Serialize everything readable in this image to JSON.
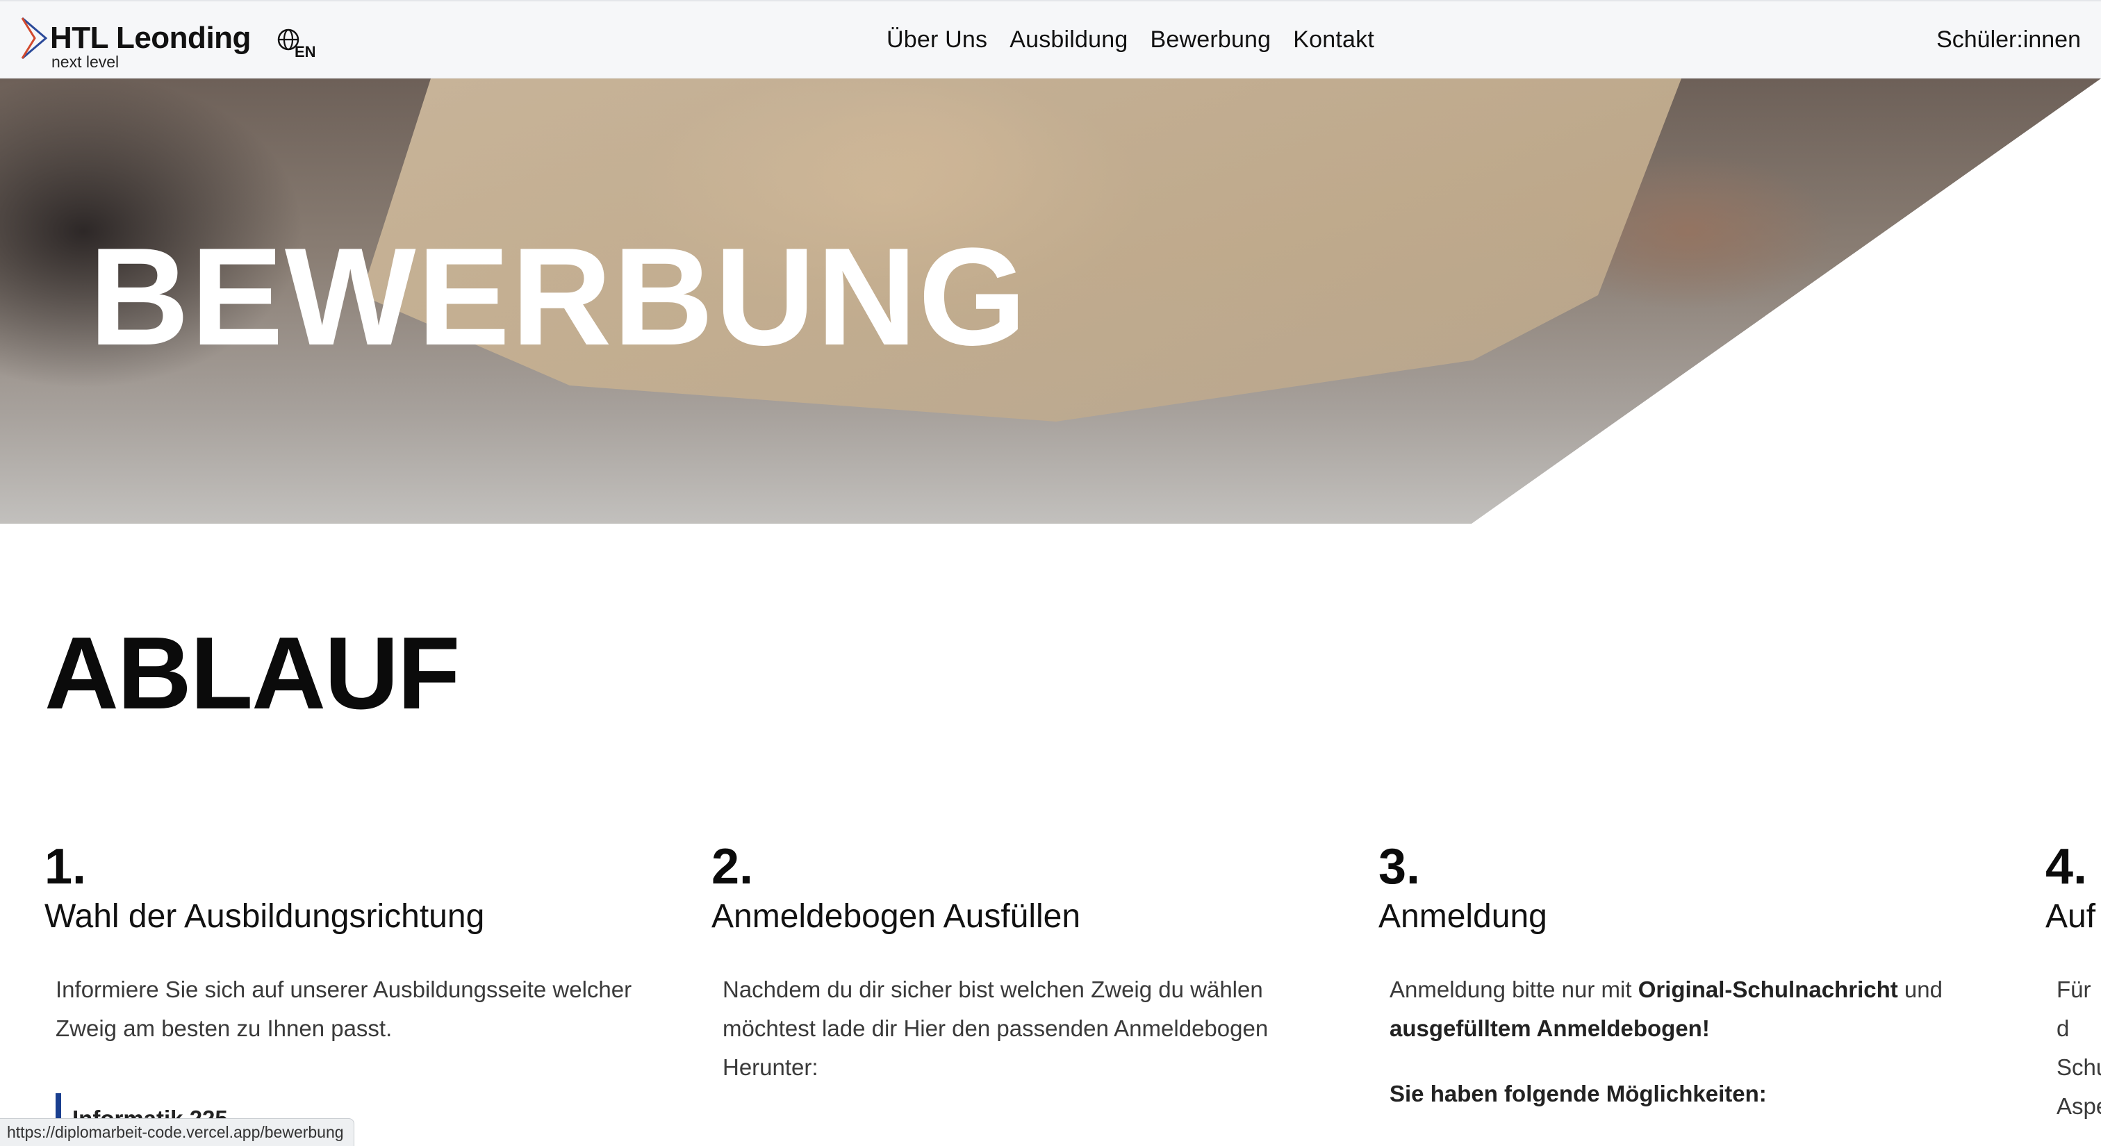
{
  "nav": {
    "logo_title": "HTL Leonding",
    "logo_subtitle": "next level",
    "language": "EN",
    "menu": [
      "Über Uns",
      "Ausbildung",
      "Bewerbung",
      "Kontakt"
    ],
    "students_link": "Schüler:innen"
  },
  "hero": {
    "title": "BEWERBUNG"
  },
  "section": {
    "title": "ABLAUF"
  },
  "steps": [
    {
      "number": "1.",
      "title": "Wahl der Ausbildungsrichtung",
      "body": "Informiere Sie sich auf unserer Ausbildungsseite welcher Zweig am besten zu Ihnen passt.",
      "info_partial": "Informatik 225"
    },
    {
      "number": "2.",
      "title": "Anmeldebogen Ausfüllen",
      "body": "Nachdem du dir sicher bist welchen Zweig du wählen möchtest lade dir Hier den passenden Anmeldebogen Herunter:"
    },
    {
      "number": "3.",
      "title": "Anmeldung",
      "body_prefix": "Anmeldung bitte nur mit ",
      "body_bold1": "Original-Schulnachricht",
      "body_mid": " und ",
      "body_bold2": "ausgefülltem Anmeldebogen!",
      "options_heading": "Sie haben folgende Möglichkeiten:"
    },
    {
      "number": "4.",
      "title": "Auf",
      "body_lines": [
        "Für d",
        "Schu",
        "Aspe"
      ]
    }
  ],
  "status_bar": {
    "url": "https://diplomarbeit-code.vercel.app/bewerbung"
  },
  "colors": {
    "accent_blue": "#1a3f8f",
    "logo_blue": "#2b4a9a",
    "logo_red": "#d24a2e"
  }
}
